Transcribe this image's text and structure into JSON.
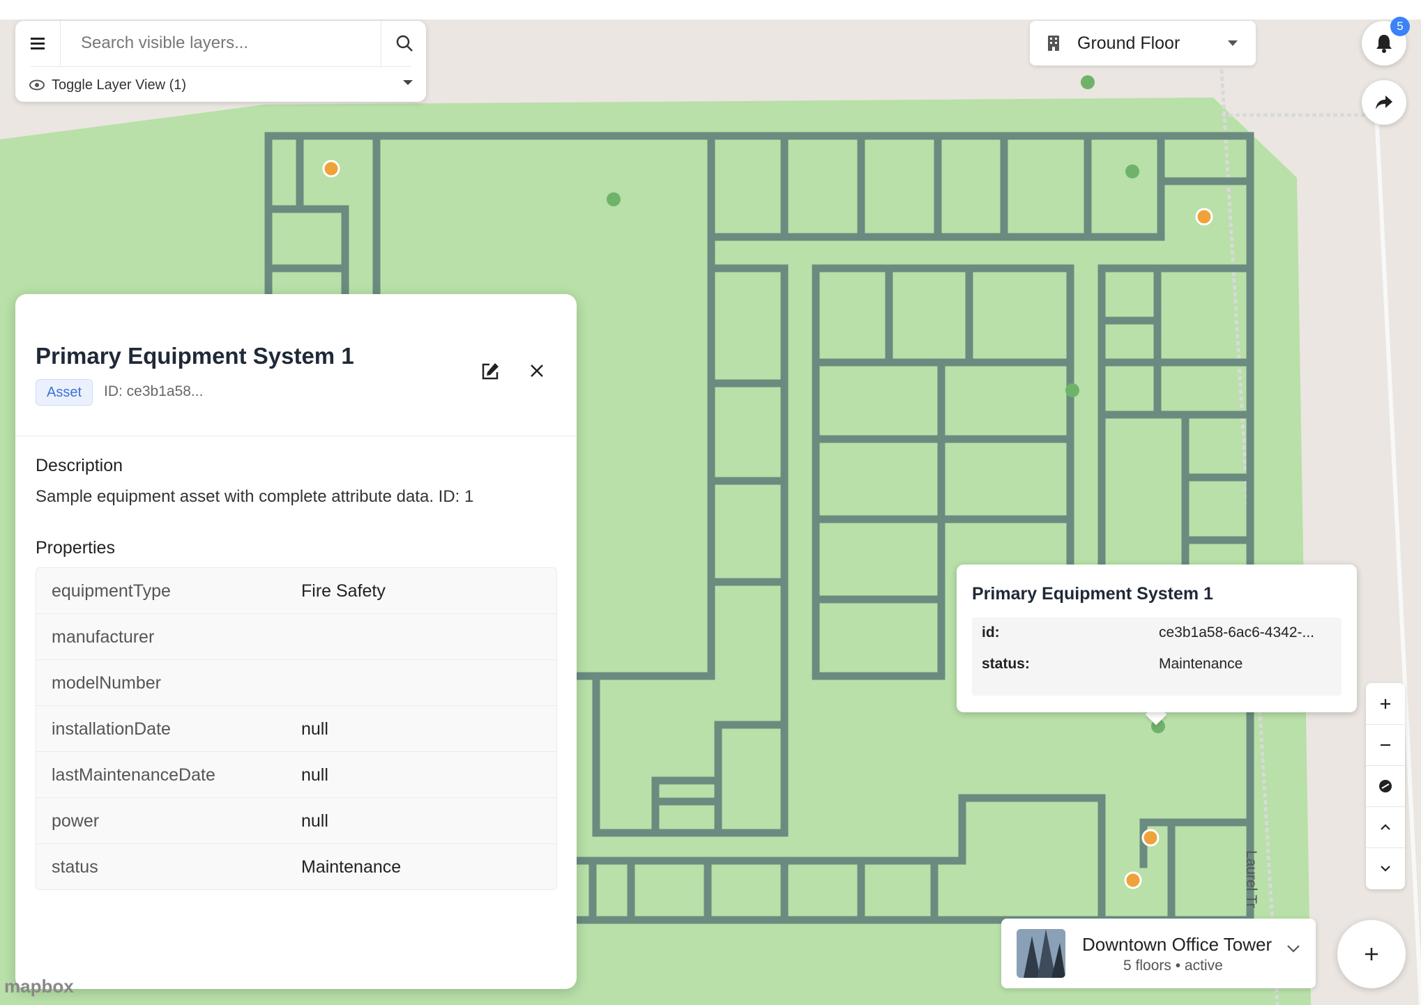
{
  "search": {
    "placeholder": "Search visible layers...",
    "layer_toggle_label": "Toggle Layer View (1)"
  },
  "floor_selector": {
    "label": "Ground Floor"
  },
  "notifications": {
    "count": "5"
  },
  "detail_panel": {
    "title": "Primary Equipment System 1",
    "type_badge": "Asset",
    "id_label": "ID: ce3b1a58...",
    "description_heading": "Description",
    "description": "Sample equipment asset with complete attribute data. ID: 1",
    "properties_heading": "Properties",
    "properties": [
      {
        "key": "equipmentType",
        "value": "Fire Safety"
      },
      {
        "key": "manufacturer",
        "value": ""
      },
      {
        "key": "modelNumber",
        "value": ""
      },
      {
        "key": "installationDate",
        "value": "null"
      },
      {
        "key": "lastMaintenanceDate",
        "value": "null"
      },
      {
        "key": "power",
        "value": "null"
      },
      {
        "key": "status",
        "value": "Maintenance"
      }
    ]
  },
  "popup": {
    "title": "Primary Equipment System 1",
    "rows": [
      {
        "key": "id:",
        "value": "ce3b1a58-6ac6-4342-..."
      },
      {
        "key": "status:",
        "value": "Maintenance"
      }
    ]
  },
  "building": {
    "name": "Downtown Office Tower",
    "meta": "5 floors • active"
  },
  "map": {
    "street_label": "Laurel Tr",
    "attribution": "mapbox"
  },
  "colors": {
    "accent": "#3b82f6",
    "map_green": "#b8e0a8",
    "wall": "#5f7f74",
    "marker_orange": "#f0a23a",
    "marker_gear": "#6fb36a"
  },
  "icons": {
    "menu": "hamburger-icon",
    "search": "search-icon",
    "layer_toggle": "eye-icon",
    "floor": "building-icon",
    "notifications": "bell-icon",
    "share": "share-icon",
    "edit": "edit-icon",
    "close": "close-icon",
    "zoom_in": "plus-icon",
    "zoom_out": "minus-icon",
    "compass": "compass-icon",
    "floor_up": "chevron-up-icon",
    "floor_down": "chevron-down-icon",
    "add": "plus-icon"
  }
}
